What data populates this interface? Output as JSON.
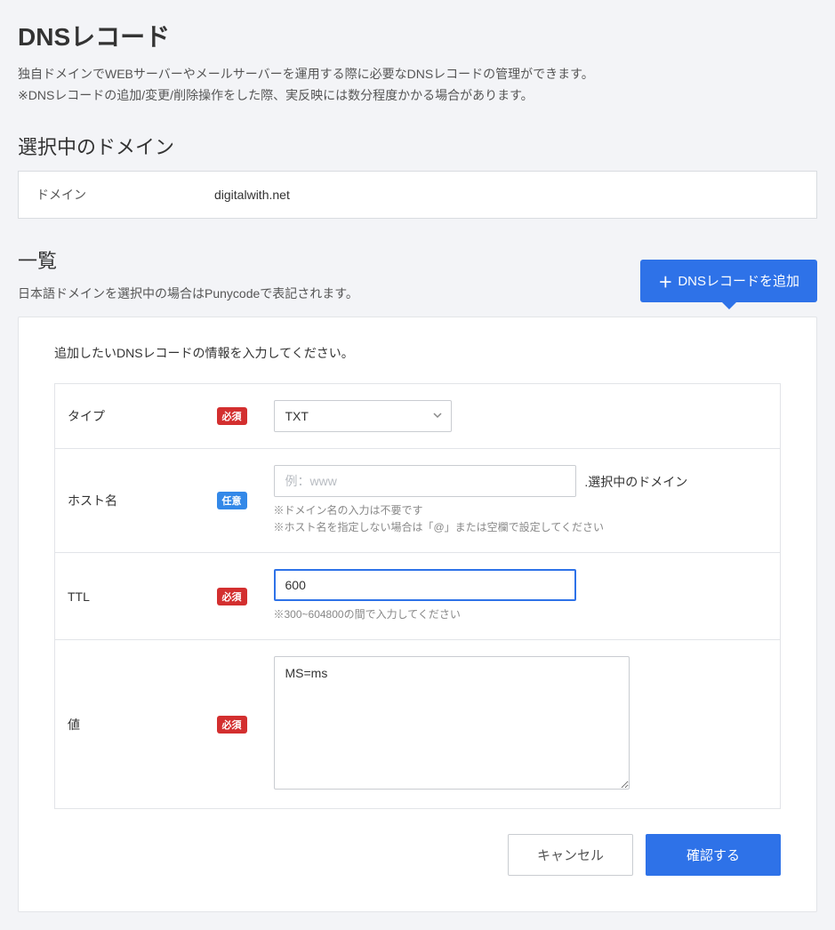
{
  "page": {
    "title": "DNSレコード",
    "description_line1": "独自ドメインでWEBサーバーやメールサーバーを運用する際に必要なDNSレコードの管理ができます。",
    "description_line2": "※DNSレコードの追加/変更/削除操作をした際、実反映には数分程度かかる場合があります。"
  },
  "selected_domain": {
    "heading": "選択中のドメイン",
    "label": "ドメイン",
    "value": "digitalwith.net"
  },
  "list": {
    "heading": "一覧",
    "note": "日本語ドメインを選択中の場合はPunycodeで表記されます。",
    "add_button": "DNSレコードを追加"
  },
  "form": {
    "intro": "追加したいDNSレコードの情報を入力してください。",
    "badges": {
      "required": "必須",
      "optional": "任意"
    },
    "type": {
      "label": "タイプ",
      "value": "TXT"
    },
    "host": {
      "label": "ホスト名",
      "placeholder": "例：www",
      "value": "",
      "suffix": ".選択中のドメイン",
      "hint1": "※ドメイン名の入力は不要です",
      "hint2": "※ホスト名を指定しない場合は「@」または空欄で設定してください"
    },
    "ttl": {
      "label": "TTL",
      "value": "600",
      "hint": "※300~604800の間で入力してください"
    },
    "value": {
      "label": "値",
      "content": "MS=ms"
    },
    "buttons": {
      "cancel": "キャンセル",
      "confirm": "確認する"
    }
  }
}
